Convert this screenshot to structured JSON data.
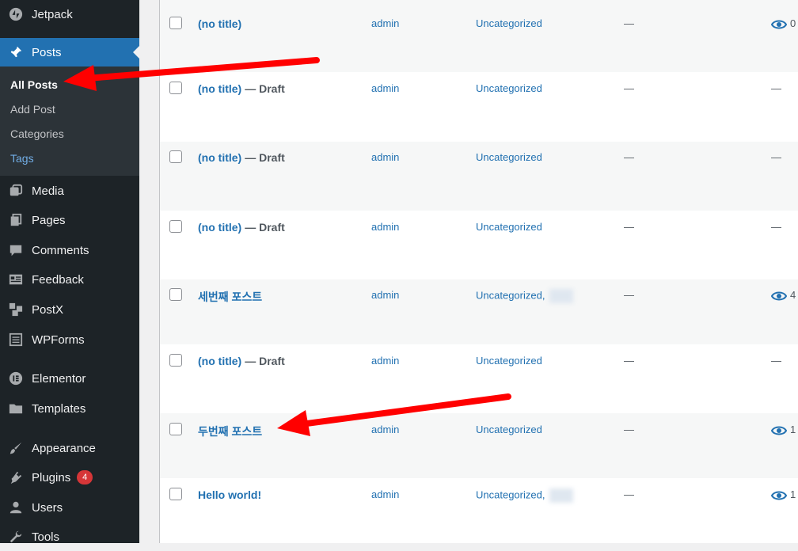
{
  "sidebar": {
    "items": [
      {
        "label": "Jetpack",
        "icon": "jetpack-icon"
      },
      {
        "label": "Posts",
        "icon": "pin-icon"
      },
      {
        "label": "Media",
        "icon": "media-icon"
      },
      {
        "label": "Pages",
        "icon": "pages-icon"
      },
      {
        "label": "Comments",
        "icon": "comment-icon"
      },
      {
        "label": "Feedback",
        "icon": "feedback-icon"
      },
      {
        "label": "PostX",
        "icon": "postx-icon"
      },
      {
        "label": "WPForms",
        "icon": "wpforms-icon"
      },
      {
        "label": "Elementor",
        "icon": "elementor-icon"
      },
      {
        "label": "Templates",
        "icon": "folder-icon"
      },
      {
        "label": "Appearance",
        "icon": "brush-icon"
      },
      {
        "label": "Plugins",
        "icon": "plugin-icon",
        "badge": "4"
      },
      {
        "label": "Users",
        "icon": "user-icon"
      },
      {
        "label": "Tools",
        "icon": "wrench-icon"
      }
    ],
    "submenu": [
      "All Posts",
      "Add Post",
      "Categories",
      "Tags"
    ]
  },
  "posts": {
    "draft_label": "— Draft",
    "rows": [
      {
        "title": "(no title)",
        "draft": false,
        "author": "admin",
        "category": "Uncategorized",
        "tags": "—",
        "stats": "0"
      },
      {
        "title": "(no title)",
        "draft": true,
        "author": "admin",
        "category": "Uncategorized",
        "tags": "—",
        "stats": "—"
      },
      {
        "title": "(no title)",
        "draft": true,
        "author": "admin",
        "category": "Uncategorized",
        "tags": "—",
        "stats": "—"
      },
      {
        "title": "(no title)",
        "draft": true,
        "author": "admin",
        "category": "Uncategorized",
        "tags": "—",
        "stats": "—"
      },
      {
        "title": "세번째 포스트",
        "draft": false,
        "author": "admin",
        "category": "Uncategorized,",
        "tags": "—",
        "stats": "4"
      },
      {
        "title": "(no title)",
        "draft": true,
        "author": "admin",
        "category": "Uncategorized",
        "tags": "—",
        "stats": "—"
      },
      {
        "title": "두번째 포스트",
        "draft": false,
        "author": "admin",
        "category": "Uncategorized",
        "tags": "—",
        "stats": "1"
      },
      {
        "title": "Hello world!",
        "draft": false,
        "author": "admin",
        "category": "Uncategorized,",
        "tags": "—",
        "stats": "1"
      }
    ]
  },
  "colors": {
    "sidebar_bg": "#1d2327",
    "active": "#2271b1",
    "link": "#2271b1",
    "arrow": "#ff0000",
    "badge": "#d63638"
  }
}
